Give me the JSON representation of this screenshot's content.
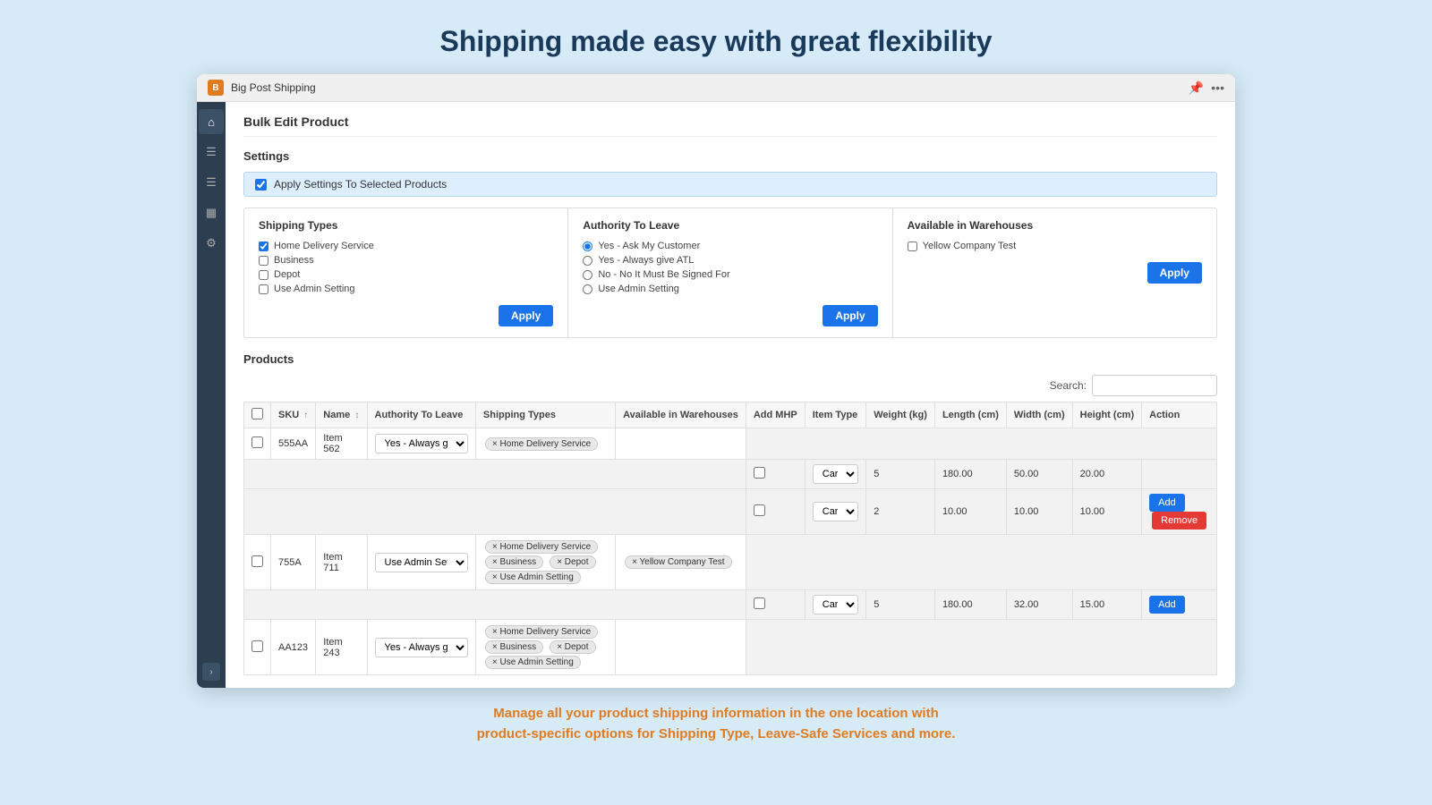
{
  "page": {
    "title": "Shipping made easy with great flexibility",
    "bottom_text_line1": "Manage all your product shipping information in the one location with",
    "bottom_text_line2": "product-specific options for Shipping Type, Leave-Safe Services and more."
  },
  "titlebar": {
    "app_name": "Big Post Shipping",
    "icon_label": "B"
  },
  "header": {
    "breadcrumb": "Bulk Edit Product"
  },
  "settings": {
    "section_label": "Settings",
    "apply_banner_label": "Apply Settings To Selected Products",
    "shipping_types": {
      "title": "Shipping Types",
      "options": [
        {
          "label": "Home Delivery Service",
          "checked": true
        },
        {
          "label": "Business",
          "checked": false
        },
        {
          "label": "Depot",
          "checked": false
        },
        {
          "label": "Use Admin Setting",
          "checked": false
        }
      ],
      "apply_label": "Apply"
    },
    "authority_to_leave": {
      "title": "Authority To Leave",
      "options": [
        {
          "label": "Yes - Ask My Customer",
          "checked": true
        },
        {
          "label": "Yes - Always give ATL",
          "checked": false
        },
        {
          "label": "No - No It Must Be Signed For",
          "checked": false
        },
        {
          "label": "Use Admin Setting",
          "checked": false
        }
      ],
      "apply_label": "Apply"
    },
    "available_warehouses": {
      "title": "Available in Warehouses",
      "options": [
        {
          "label": "Yellow Company Test",
          "checked": false
        }
      ],
      "apply_label": "Apply"
    }
  },
  "products": {
    "section_label": "Products",
    "search_label": "Search:",
    "search_value": "",
    "columns": [
      "",
      "SKU",
      "Name",
      "Authority To Leave",
      "Shipping Types",
      "Available in Warehouses",
      "Add MHP",
      "Item Type",
      "Weight (kg)",
      "Length (cm)",
      "Width (cm)",
      "Height (cm)",
      "Action"
    ],
    "rows": [
      {
        "id": "row1",
        "checkbox": false,
        "sku": "555AA",
        "name": "Item 562",
        "authority": "Yes - Always give ATL",
        "shipping_types": [
          "× Home Delivery Service"
        ],
        "warehouses": [],
        "sub_rows": [
          {
            "mhp": false,
            "item_type": "Cartor",
            "weight": "5",
            "length": "180.00",
            "width": "50.00",
            "height": "20.00",
            "actions": []
          },
          {
            "mhp": false,
            "item_type": "Cartor",
            "weight": "2",
            "length": "10.00",
            "width": "10.00",
            "height": "10.00",
            "actions": [
              "Add",
              "Remove"
            ]
          }
        ]
      },
      {
        "id": "row2",
        "checkbox": false,
        "sku": "755A",
        "name": "Item 711",
        "authority": "Use Admin Setting",
        "shipping_types": [
          "× Home Delivery Service",
          "× Business",
          "× Depot",
          "× Use Admin Setting"
        ],
        "warehouses": [
          "× Yellow Company Test"
        ],
        "sub_rows": [
          {
            "mhp": false,
            "item_type": "Cartor",
            "weight": "5",
            "length": "180.00",
            "width": "32.00",
            "height": "15.00",
            "actions": [
              "Add"
            ]
          }
        ]
      },
      {
        "id": "row3",
        "checkbox": false,
        "sku": "AA123",
        "name": "Item 243",
        "authority": "Yes - Always give ATL",
        "shipping_types": [
          "× Home Delivery Service",
          "× Business",
          "× Depot",
          "× Use Admin Setting"
        ],
        "warehouses": [],
        "sub_rows": []
      }
    ]
  }
}
